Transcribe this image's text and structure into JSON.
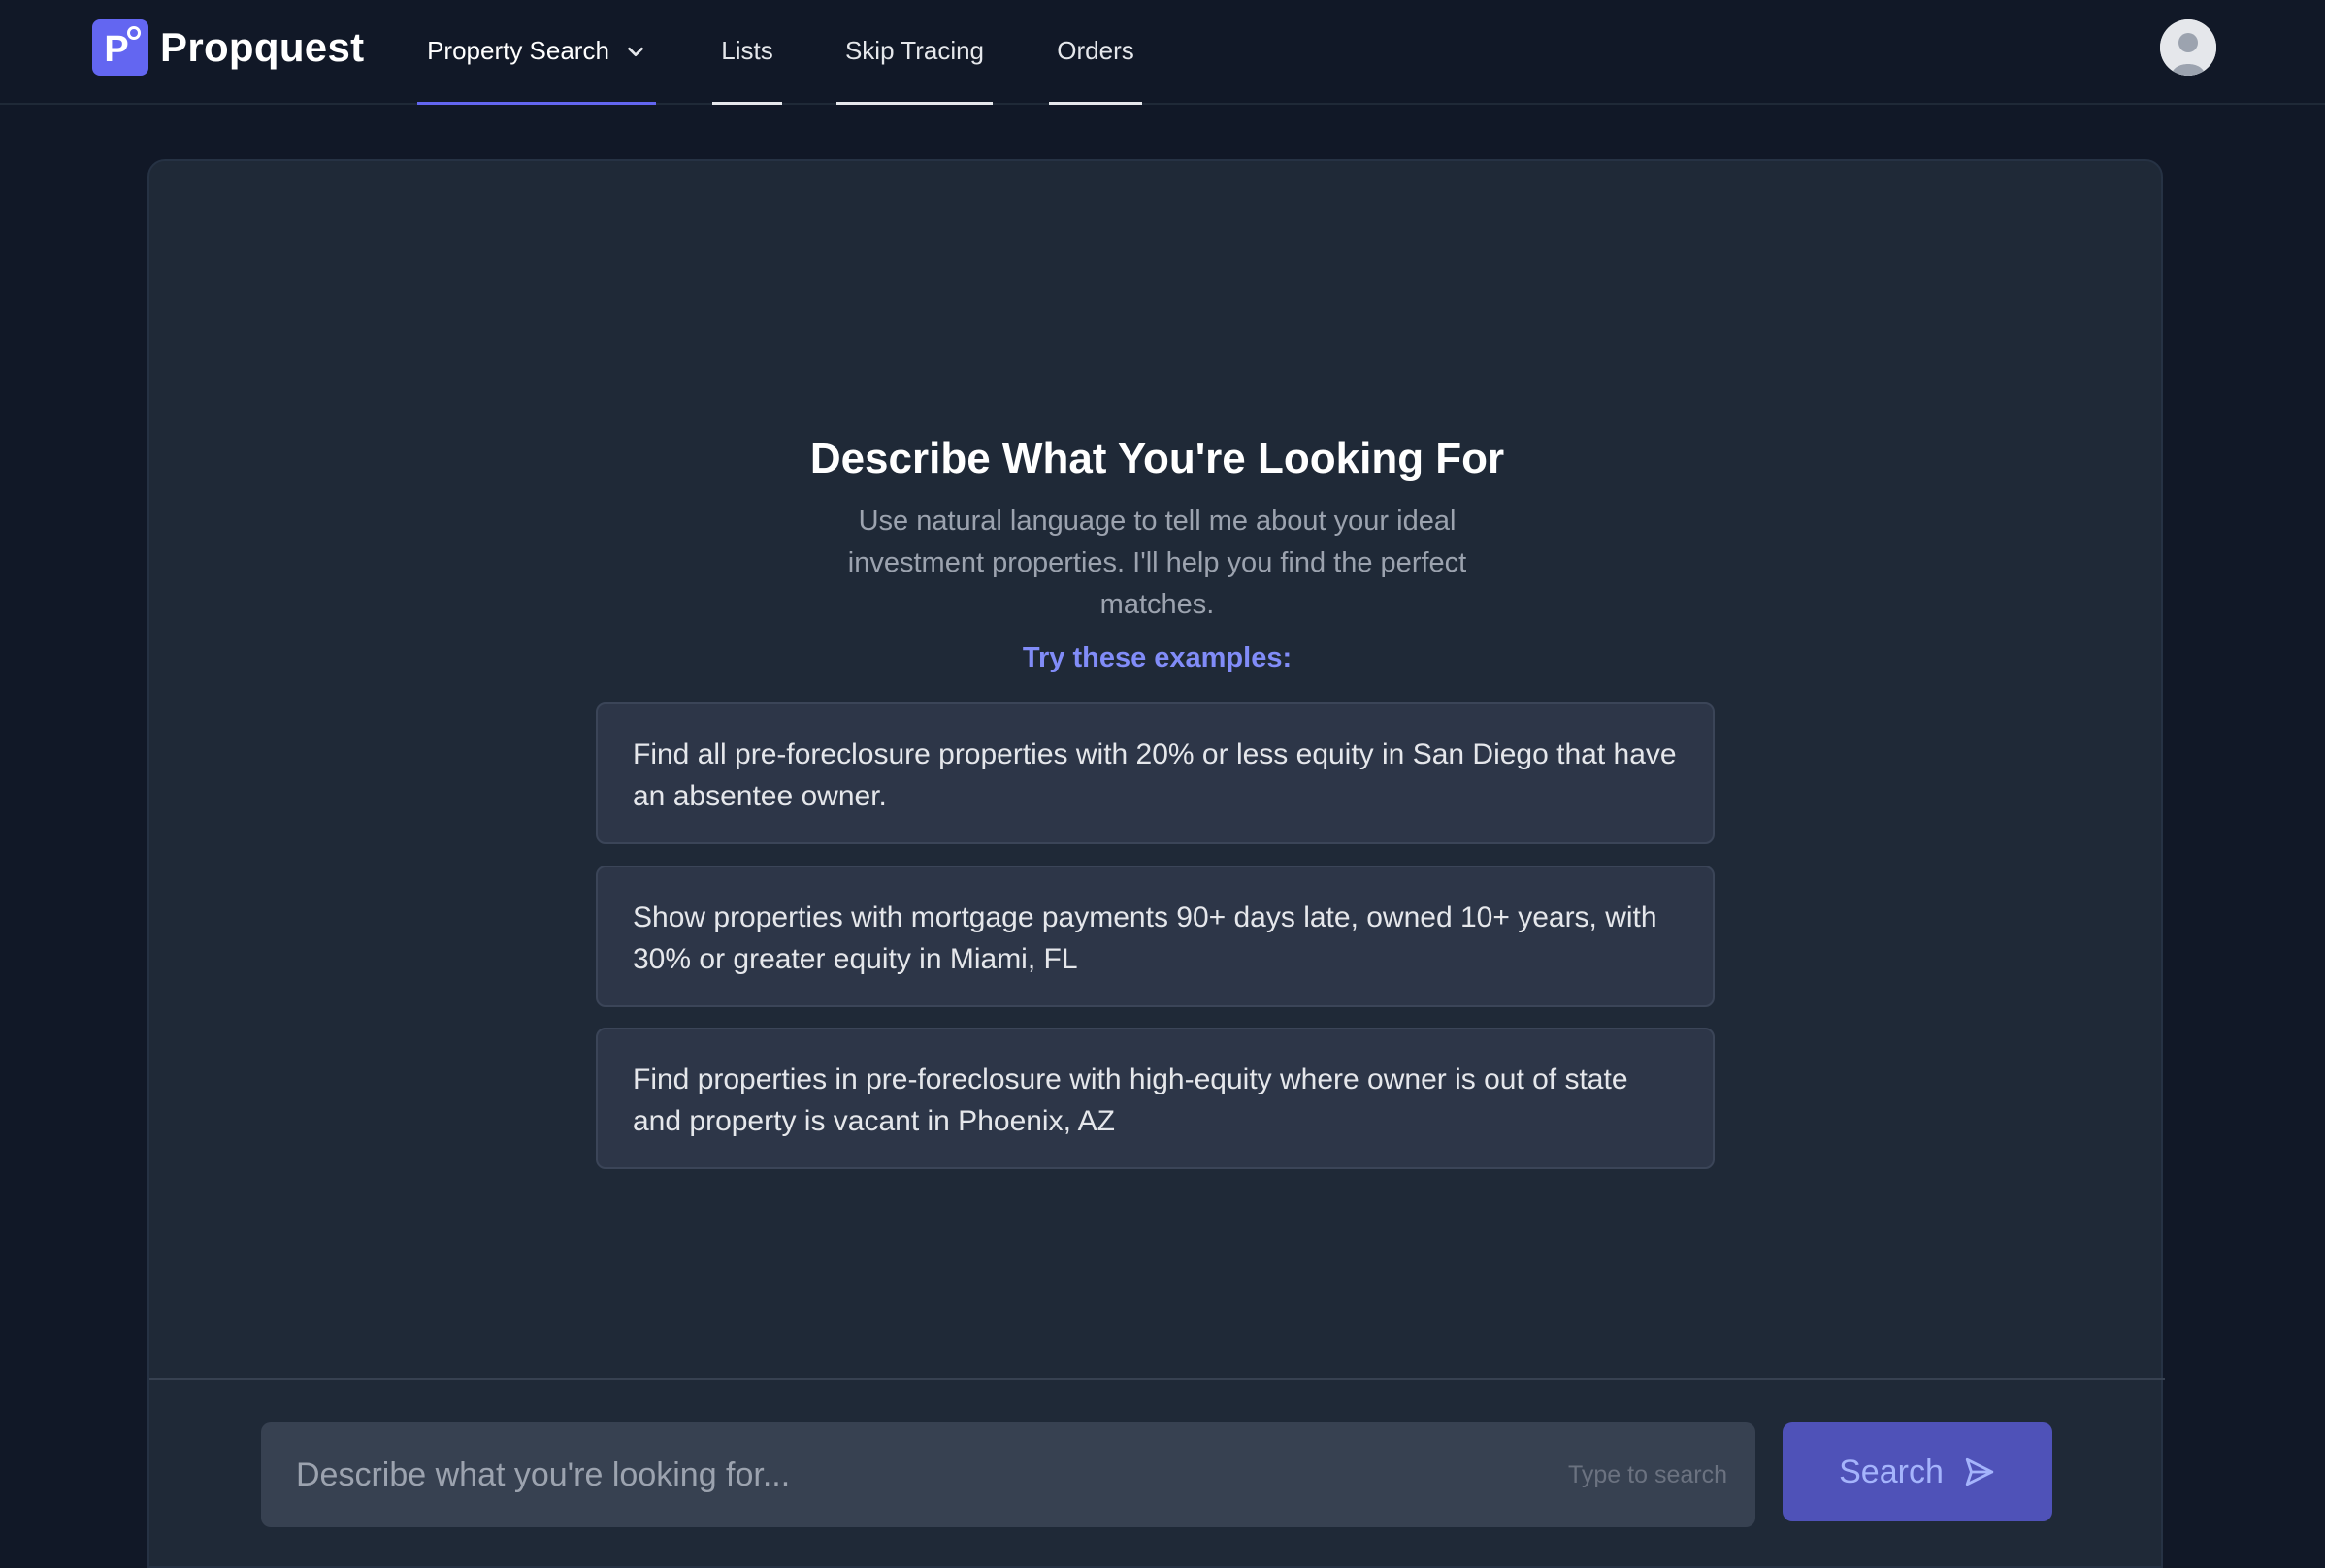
{
  "app": {
    "logo_letter": "P",
    "name": "Propquest"
  },
  "nav": {
    "tabs": [
      {
        "label": "Property Search",
        "active": true,
        "has_dropdown": true
      },
      {
        "label": "Lists",
        "active": false
      },
      {
        "label": "Skip Tracing",
        "active": false
      },
      {
        "label": "Orders",
        "active": false
      }
    ]
  },
  "main": {
    "heading": "Describe What You're Looking For",
    "subheading": "Use natural language to tell me about your ideal investment properties. I'll help you find the perfect matches.",
    "examples_label": "Try these examples:",
    "examples": [
      "Find all pre-foreclosure properties with 20% or less equity in San Diego that have an absentee owner.",
      "Show properties with mortgage payments 90+ days late, owned 10+ years, with 30% or greater equity in Miami, FL",
      "Find properties in pre-foreclosure with high-equity where owner is out of state and property is vacant in Phoenix, AZ"
    ]
  },
  "search": {
    "value": "",
    "placeholder": "Describe what you're looking for...",
    "hint": "Type to search",
    "button_label": "Search"
  },
  "colors": {
    "accent": "#6366f1",
    "background": "#111827",
    "card": "#1f2937",
    "example_bg": "#2d3648",
    "examples_label": "#818cf8",
    "search_button": "#4f52b8"
  },
  "icons": {
    "dropdown": "chevron-down-icon",
    "avatar": "user-avatar-icon",
    "send": "send-icon"
  }
}
